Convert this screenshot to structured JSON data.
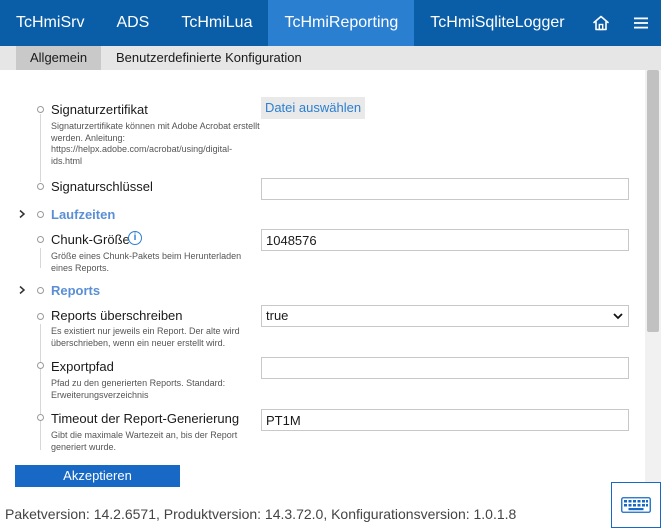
{
  "nav": {
    "tabs": [
      {
        "label": "TcHmiSrv"
      },
      {
        "label": "ADS"
      },
      {
        "label": "TcHmiLua"
      },
      {
        "label": "TcHmiReporting"
      },
      {
        "label": "TcHmiSqliteLogger"
      }
    ],
    "active_index": 3,
    "home_icon": "home-icon",
    "menu_icon": "hamburger-menu-icon"
  },
  "subtabs": {
    "general": "Allgemein",
    "custom": "Benutzerdefinierte Konfiguration"
  },
  "settings": {
    "signature_cert": {
      "label": "Signaturzertifikat",
      "desc": "Signaturzertifikate können mit Adobe Acrobat erstellt werden. Anleitung: https://helpx.adobe.com/acrobat/using/digital-ids.html",
      "button": "Datei auswählen"
    },
    "signature_key": {
      "label": "Signaturschlüssel",
      "value": ""
    },
    "group_runtimes": "Laufzeiten",
    "chunk_size": {
      "label": "Chunk-Größe",
      "desc": "Größe eines Chunk-Pakets beim Herunterladen eines Reports.",
      "value": "1048576",
      "info": "i"
    },
    "group_reports": "Reports",
    "overwrite_reports": {
      "label": "Reports überschreiben",
      "desc": "Es existiert nur jeweils ein Report. Der alte wird überschrieben, wenn ein neuer erstellt wird.",
      "value": "true"
    },
    "export_path": {
      "label": "Exportpfad",
      "desc": "Pfad zu den generierten Reports. Standard: Erweiterungsverzeichnis",
      "value": ""
    },
    "timeout": {
      "label": "Timeout der Report-Generierung",
      "desc": "Gibt die maximale Wartezeit an, bis der Report generiert wurde.",
      "value": "PT1M"
    }
  },
  "accept_label": "Akzeptieren",
  "footer": "Paketversion: 14.2.6571, Produktversion: 14.3.72.0, Konfigurationsversion: 1.0.1.8",
  "colors": {
    "nav_bg": "#0a5ea8",
    "nav_active": "#2b7fd1",
    "group_title": "#5a8fd6",
    "accept_bg": "#1769c5"
  }
}
